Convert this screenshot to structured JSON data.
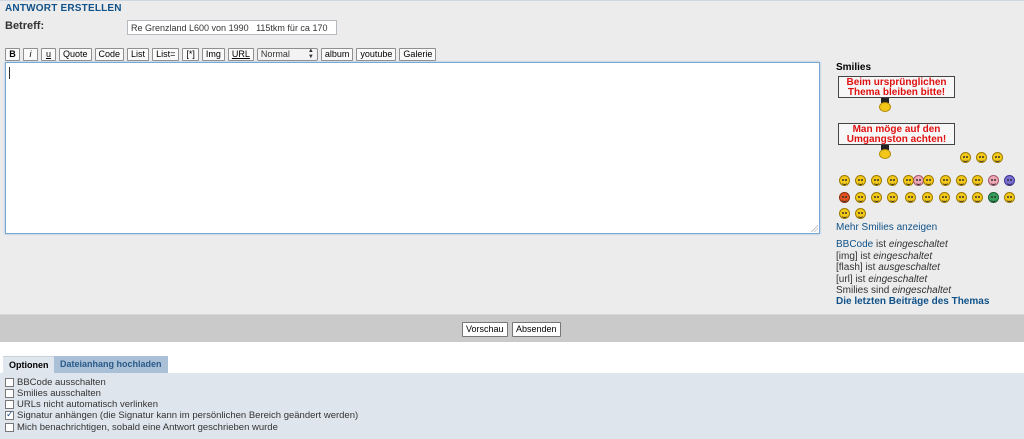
{
  "heading": "ANTWORT ERSTELLEN",
  "subject": {
    "label": "Betreff:",
    "value": "Re Grenzland L600 von 1990   115tkm für ca 170"
  },
  "toolbar": {
    "bold": "B",
    "italic": "i",
    "underline": "u",
    "quote": "Quote",
    "code": "Code",
    "list": "List",
    "list_eq": "List=",
    "list_item": "[*]",
    "img": "Img",
    "url": "URL",
    "size": "Normal",
    "album": "album",
    "youtube": "youtube",
    "galerie": "Galerie"
  },
  "smilies": {
    "title": "Smilies",
    "sign1": "Beim ursprünglichen Thema bleiben bitte!",
    "sign2": "Man möge auf den Umgangston achten!",
    "more": "Mehr Smilies anzeigen"
  },
  "status": {
    "bbcode_link": "BBCode",
    "bbcode_rest": " ist ",
    "bbcode_state": "eingeschaltet",
    "img_pre": "[img] ist ",
    "img_state": "eingeschaltet",
    "flash_pre": "[flash] ist ",
    "flash_state": "ausgeschaltet",
    "url_pre": "[url] ist ",
    "url_state": "eingeschaltet",
    "smilies_pre": "Smilies sind ",
    "smilies_state": "eingeschaltet"
  },
  "latest_link": "Die letzten Beiträge des Themas",
  "buttons": {
    "preview": "Vorschau",
    "submit": "Absenden"
  },
  "tabs": {
    "options": "Optionen",
    "attach": "Dateianhang hochladen"
  },
  "options": [
    {
      "label": "BBCode ausschalten",
      "checked": false
    },
    {
      "label": "Smilies ausschalten",
      "checked": false
    },
    {
      "label": "URLs nicht automatisch verlinken",
      "checked": false
    },
    {
      "label": "Signatur anhängen (die Signatur kann im persönlichen Bereich geändert werden)",
      "checked": true
    },
    {
      "label": "Mich benachrichtigen, sobald eine Antwort geschrieben wurde",
      "checked": false
    }
  ],
  "colors": {
    "link": "#105289",
    "sign_text": "#e01010",
    "tab_inactive": "#a9c0d6",
    "options_bg": "#dfe5ec"
  }
}
